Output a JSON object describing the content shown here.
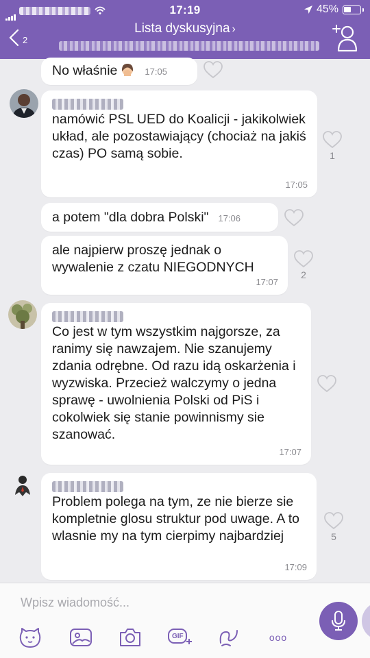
{
  "status_bar": {
    "time": "17:19",
    "battery": "45%",
    "battery_level": 0.45
  },
  "header": {
    "back_count": "2",
    "title": "Lista dyskusyjna",
    "title_chevron": "›",
    "icons": [
      "chevron-left-icon",
      "add-participant-icon"
    ]
  },
  "messages": [
    {
      "text": "No właśnie",
      "emoji": "woman-facepalming-emoji",
      "time": "17:05",
      "likes": ""
    },
    {
      "text": "namówić PSL UED do Koalicji - jakikolwiek układ, ale pozostawiający (chociaż na jakiś czas) PO samą sobie.",
      "time": "17:05",
      "likes": "1"
    },
    {
      "text": "a potem \"dla dobra Polski\"",
      "time": "17:06",
      "likes": ""
    },
    {
      "text": "ale najpierw proszę jednak o wywalenie z czatu NIEGODNYCH",
      "time": "17:07",
      "likes": "2"
    },
    {
      "text": "Co jest w tym wszystkim najgorsze, za ranimy się nawzajem. Nie szanujemy zdania odrębne. Od razu idą oskarżenia i wyzwiska. Przecież walczymy o jedna sprawę - uwolnienia Polski od PiS i cokolwiek się stanie powinnismy sie szanować.",
      "time": "17:07",
      "likes": ""
    },
    {
      "text": "Problem polega na tym, ze nie bierze sie kompletnie glosu struktur pod uwage. A to wlasnie my na tym cierpimy najbardziej",
      "time": "17:09",
      "likes": "5"
    }
  ],
  "composer": {
    "placeholder": "Wpisz wiadomość...",
    "toolbar": [
      "sticker-icon",
      "gallery-icon",
      "camera-icon",
      "gif-icon",
      "doodle-icon",
      "more-icon"
    ],
    "gif_label": "GIF",
    "more_label": "ooo",
    "accent": "#7b5fb5"
  },
  "colors": {
    "header": "#7b5fb5",
    "chat_background": "#ececef",
    "bubble": "#ffffff"
  }
}
